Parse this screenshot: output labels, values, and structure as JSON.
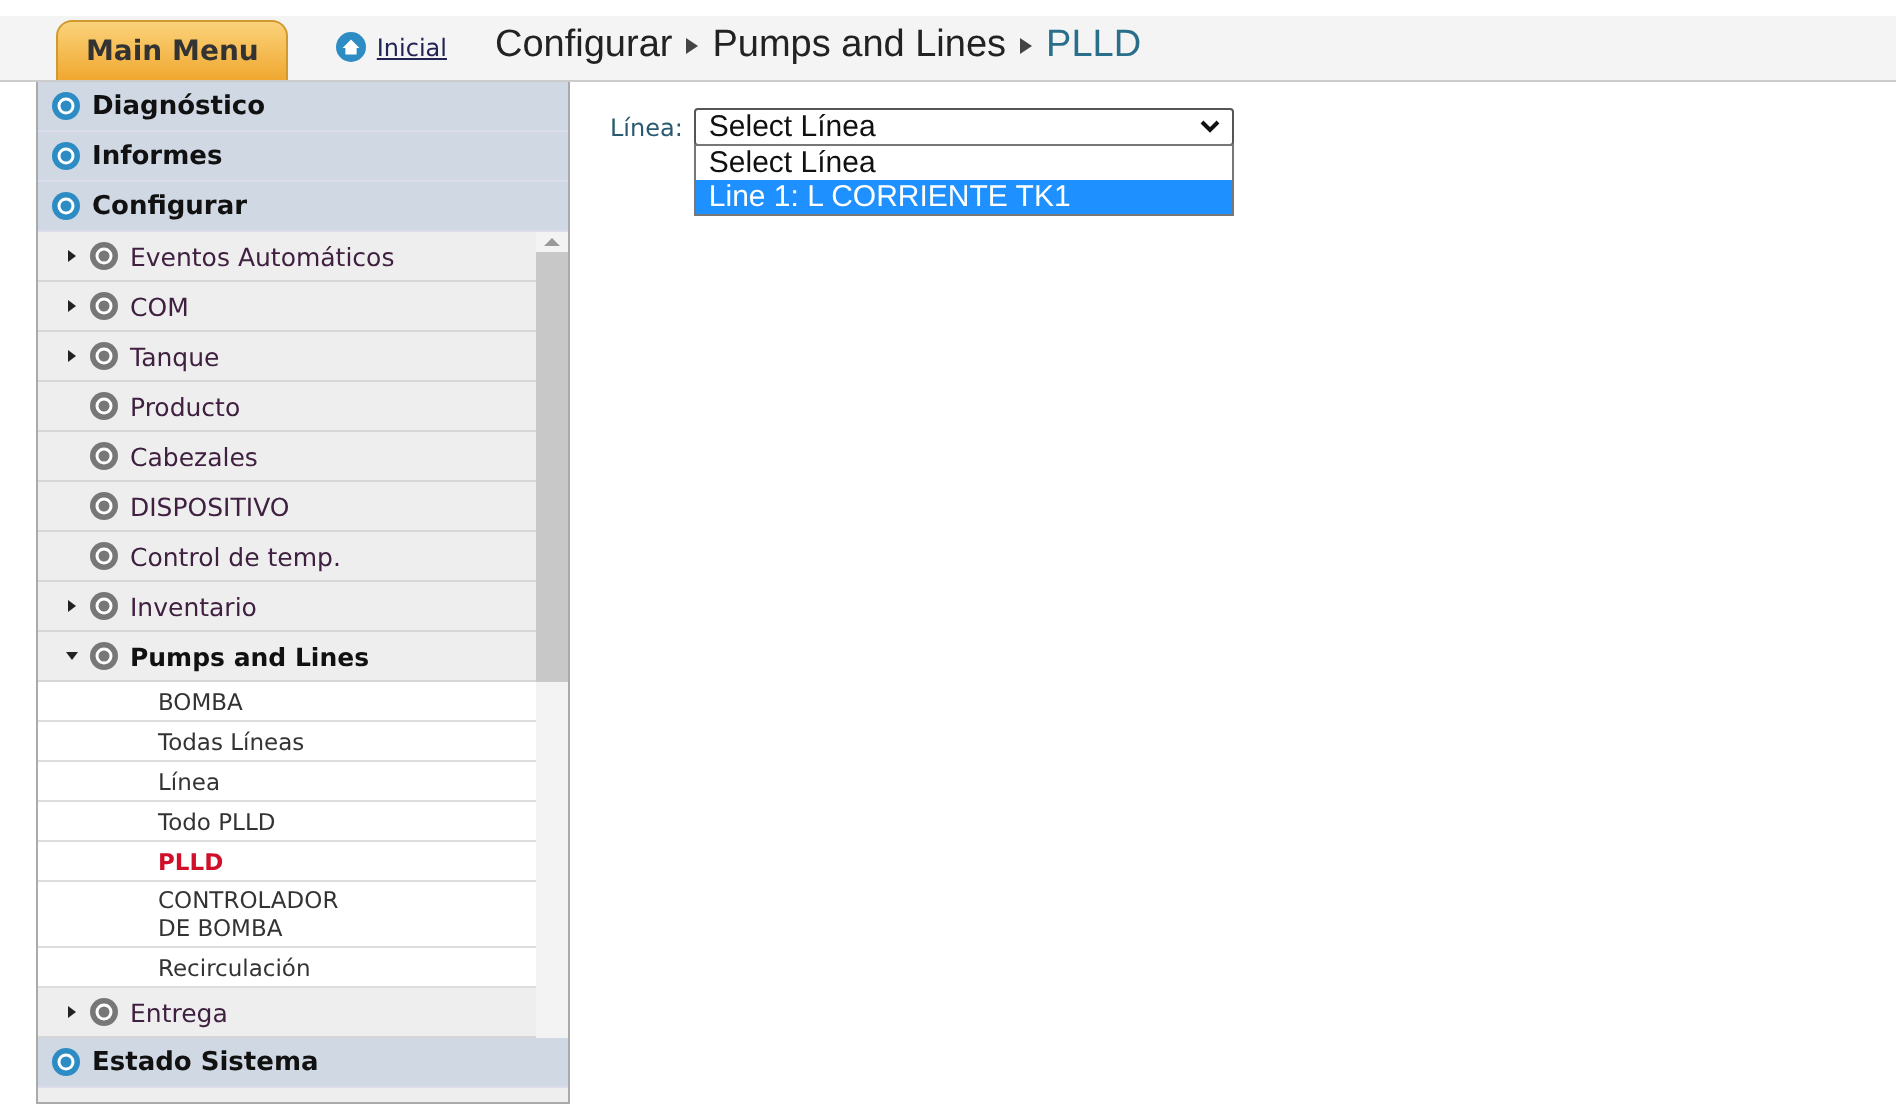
{
  "top_bar": {
    "main_menu": "Main Menu",
    "home_link": "Inicial",
    "breadcrumb": [
      {
        "label": "Configurar",
        "current": false
      },
      {
        "label": "Pumps and Lines",
        "current": false
      },
      {
        "label": "PLLD",
        "current": true
      }
    ]
  },
  "sidebar": {
    "sections_top": [
      {
        "label": "Diagnóstico"
      },
      {
        "label": "Informes"
      },
      {
        "label": "Configurar"
      }
    ],
    "items": [
      {
        "label": "Eventos Automáticos",
        "expanded": false
      },
      {
        "label": "COM",
        "expanded": false
      },
      {
        "label": "Tanque",
        "expanded": false
      },
      {
        "label": "Producto"
      },
      {
        "label": "Cabezales"
      },
      {
        "label": "DISPOSITIVO"
      },
      {
        "label": "Control de temp."
      },
      {
        "label": "Inventario",
        "expanded": false
      },
      {
        "label": "Pumps and Lines",
        "expanded": true,
        "children": [
          {
            "label": "BOMBA",
            "selected": false
          },
          {
            "label": "Todas Líneas",
            "selected": false
          },
          {
            "label": "Línea",
            "selected": false
          },
          {
            "label": "Todo PLLD",
            "selected": false
          },
          {
            "label": "PLLD",
            "selected": true
          },
          {
            "label": "CONTROLADOR DE BOMBA",
            "selected": false
          },
          {
            "label": "Recirculación",
            "selected": false
          }
        ]
      },
      {
        "label": "Entrega",
        "expanded": false
      }
    ],
    "sections_bottom": [
      {
        "label": "Estado Sistema"
      }
    ]
  },
  "form": {
    "label": "Línea:",
    "select": {
      "value": "Select Línea",
      "open": true,
      "options": [
        {
          "label": "Select Línea",
          "highlighted": false
        },
        {
          "label": "Line 1: L CORRIENTE TK1",
          "highlighted": true
        }
      ]
    }
  }
}
